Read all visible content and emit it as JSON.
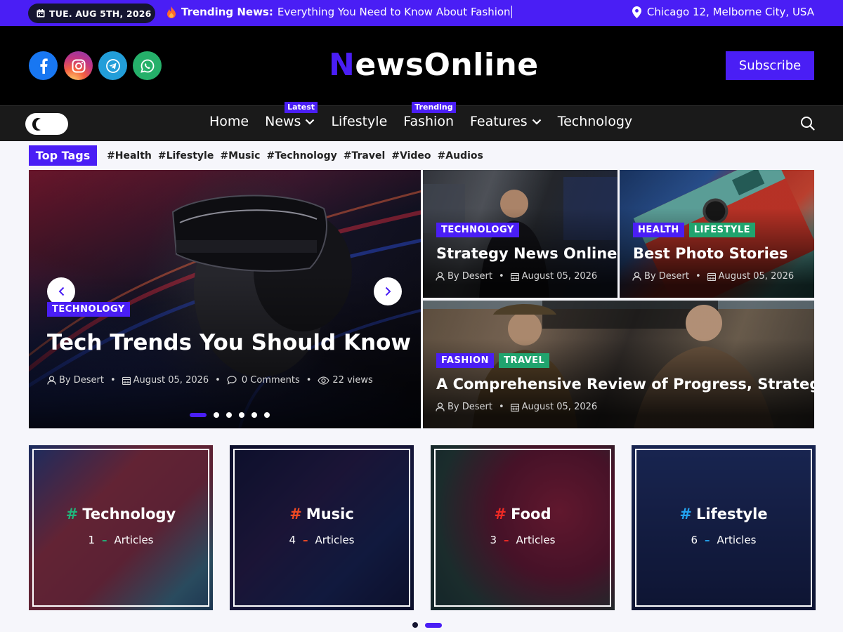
{
  "topbar": {
    "date": "TUE. AUG 5TH, 2026",
    "trending_label": "Trending News:",
    "trending_text": "Everything You Need to Know About Fashion",
    "location": "Chicago 12, Melborne City, USA"
  },
  "header": {
    "logo_first": "N",
    "logo_rest": "ewsOnline",
    "subscribe": "Subscribe",
    "social": [
      "facebook-icon",
      "instagram-icon",
      "telegram-icon",
      "whatsapp-icon"
    ]
  },
  "nav": {
    "items": [
      {
        "label": "Home"
      },
      {
        "label": "News",
        "badge": "Latest",
        "dropdown": true
      },
      {
        "label": "Lifestyle"
      },
      {
        "label": "Fashion",
        "badge": "Trending"
      },
      {
        "label": "Features",
        "dropdown": true
      },
      {
        "label": "Technology"
      }
    ]
  },
  "tags": {
    "label": "Top Tags",
    "items": [
      "#Health",
      "#Lifestyle",
      "#Music",
      "#Technology",
      "#Travel",
      "#Video",
      "#Audios"
    ]
  },
  "hero": {
    "category": "TECHNOLOGY",
    "title": "Tech Trends You Should Know",
    "author": "By Desert",
    "date": "August 05, 2026",
    "comments": "0 Comments",
    "views": "22 views",
    "slides": 6,
    "active_slide": 1
  },
  "cards": [
    {
      "categories": [
        "TECHNOLOGY"
      ],
      "title": "Strategy News Online",
      "author": "By Desert",
      "date": "August 05, 2026"
    },
    {
      "categories": [
        "HEALTH",
        "LIFESTYLE"
      ],
      "title": "Best Photo Stories",
      "author": "By Desert",
      "date": "August 05, 2026"
    },
    {
      "categories": [
        "FASHION",
        "TRAVEL"
      ],
      "title": "A Comprehensive Review of Progress, Strategy.",
      "author": "By Desert",
      "date": "August 05, 2026"
    }
  ],
  "categories": [
    {
      "name": "Technology",
      "count": "1",
      "articles": "Articles",
      "accent": "#20b47a"
    },
    {
      "name": "Music",
      "count": "4",
      "articles": "Articles",
      "accent": "#ef4a24"
    },
    {
      "name": "Food",
      "count": "3",
      "articles": "Articles",
      "accent": "#ef2a24"
    },
    {
      "name": "Lifestyle",
      "count": "6",
      "articles": "Articles",
      "accent": "#23a4f0"
    }
  ],
  "colors": {
    "brand": "#4a1ef5",
    "green": "#20a46e",
    "dark": "#000000"
  }
}
